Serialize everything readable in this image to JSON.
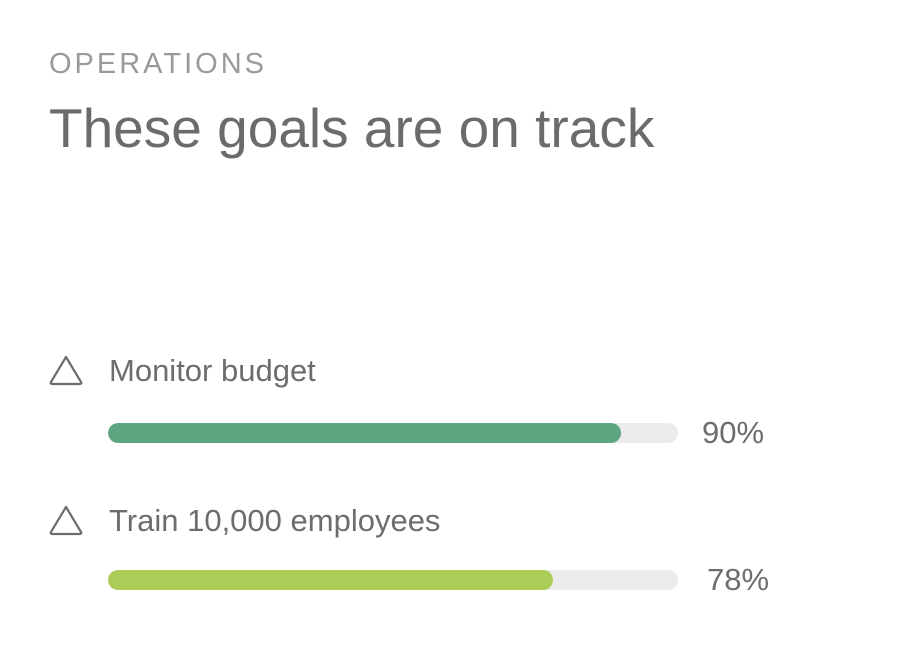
{
  "section": {
    "eyebrow": "OPERATIONS",
    "headline": "These goals are on track"
  },
  "goals": [
    {
      "label": "Monitor budget",
      "progress_percent": 90,
      "progress_text": "90%",
      "bar_color": "#5ea681",
      "icon": "triangle-icon"
    },
    {
      "label": "Train 10,000 employees",
      "progress_percent": 78,
      "progress_text": "78%",
      "bar_color": "#abcd57",
      "icon": "triangle-icon"
    }
  ],
  "colors": {
    "track": "#ebebeb",
    "text": "#6b6b6b",
    "eyebrow": "#9a9a9a"
  }
}
